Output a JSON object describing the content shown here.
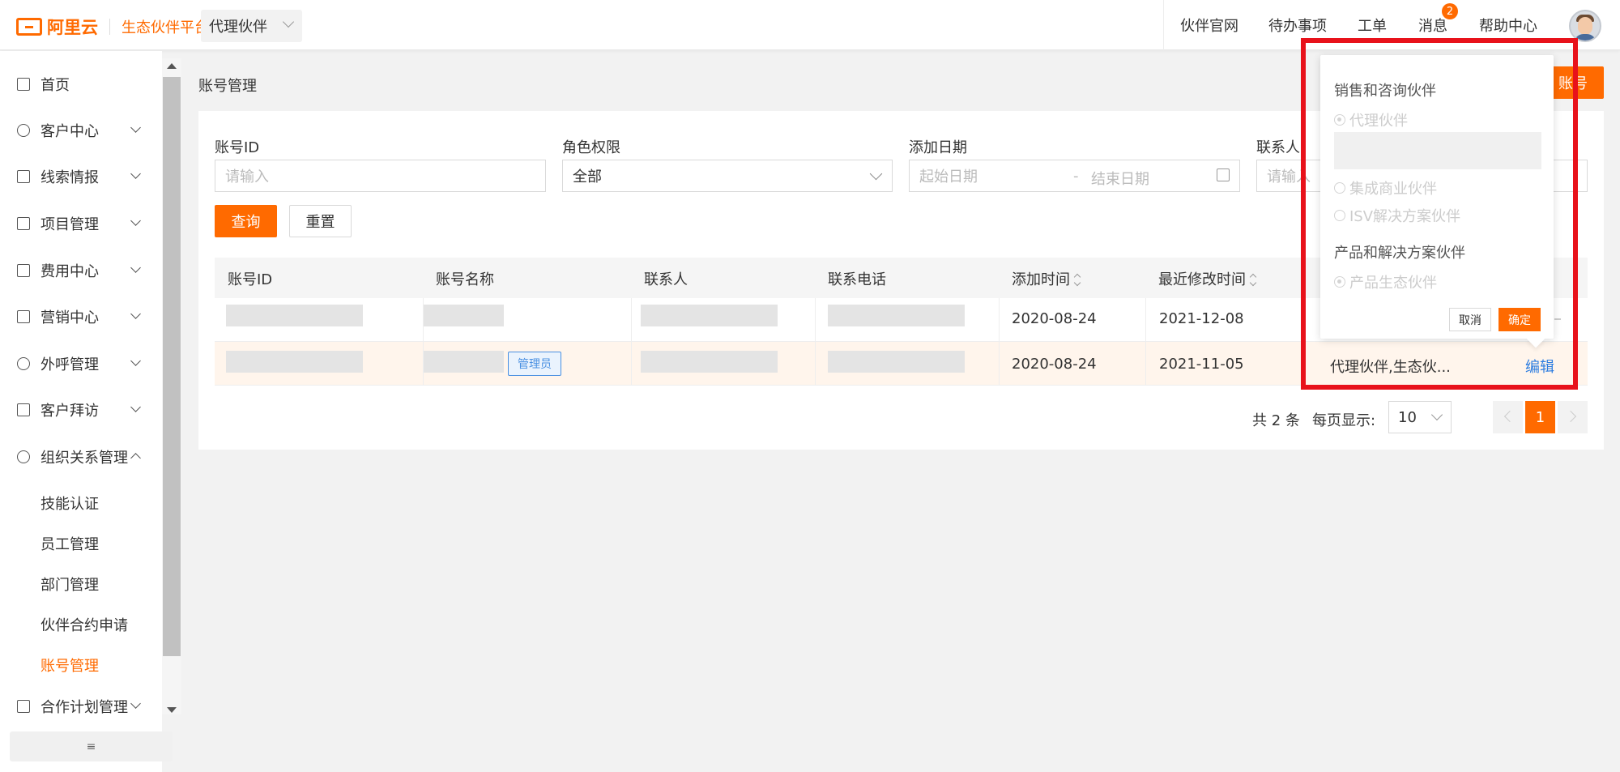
{
  "header": {
    "brand": "阿里云",
    "platform": "生态伙伴平台",
    "role_select": "代理伙伴",
    "nav": [
      "伙伴官网",
      "待办事项",
      "工单",
      "消息",
      "帮助中心"
    ],
    "message_badge": "2"
  },
  "sidebar": {
    "items": [
      {
        "label": "首页",
        "icon": "home-icon"
      },
      {
        "label": "客户中心",
        "icon": "customer-icon"
      },
      {
        "label": "线索情报",
        "icon": "leads-icon"
      },
      {
        "label": "项目管理",
        "icon": "project-icon"
      },
      {
        "label": "费用中心",
        "icon": "fee-icon"
      },
      {
        "label": "营销中心",
        "icon": "bag-icon"
      },
      {
        "label": "外呼管理",
        "icon": "phone-icon"
      },
      {
        "label": "客户拜访",
        "icon": "calendar-icon"
      },
      {
        "label": "组织关系管理",
        "icon": "share-icon"
      }
    ],
    "sub_items": [
      "技能认证",
      "员工管理",
      "部门管理",
      "伙伴合约申请",
      "账号管理"
    ],
    "bottom_item": "合作计划管理",
    "collapse_icon": "≡"
  },
  "page": {
    "title": "账号管理",
    "add_button": "账号"
  },
  "filters": {
    "account_id": {
      "label": "账号ID",
      "placeholder": "请输入"
    },
    "role": {
      "label": "角色权限",
      "value": "全部"
    },
    "date": {
      "label": "添加日期",
      "start": "起始日期",
      "sep": "-",
      "end": "结束日期"
    },
    "contact": {
      "label": "联系人",
      "placeholder": "请输入"
    },
    "query": "查询",
    "reset": "重置"
  },
  "table": {
    "columns": [
      "账号ID",
      "账号名称",
      "联系人",
      "联系电话",
      "添加时间",
      "最近修改时间"
    ],
    "rows": [
      {
        "added": "2020-08-24",
        "modified": "2021-12-08"
      },
      {
        "added": "2020-08-24",
        "modified": "2021-11-05",
        "tag": "管理员",
        "roles": "代理伙伴,生态伙...",
        "action": "编辑"
      }
    ]
  },
  "pager": {
    "total": "共 2 条",
    "per_page_label": "每页显示:",
    "per_page": "10",
    "current": "1"
  },
  "popover": {
    "group1": "销售和咨询伙伴",
    "opt_agent": "代理伙伴",
    "opt_integrator": "集成商业伙伴",
    "opt_isv": "ISV解决方案伙伴",
    "group2": "产品和解决方案伙伴",
    "opt_eco": "产品生态伙伴",
    "cancel": "取消",
    "ok": "确定"
  },
  "colors": {
    "accent": "#ff6a00",
    "link": "#2f7ee0",
    "highlight": "#e8121b"
  }
}
